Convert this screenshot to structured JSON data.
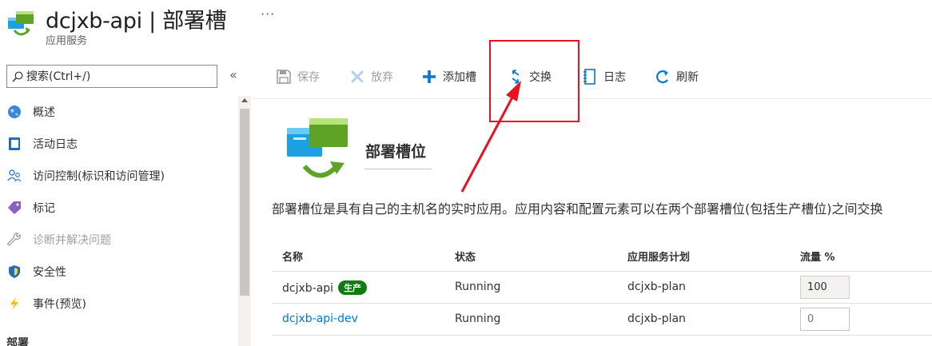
{
  "header": {
    "title": "dcjxb-api | 部署槽",
    "more": "···",
    "subtitle": "应用服务",
    "icon": "app-service-slots-icon"
  },
  "sidebar": {
    "search_placeholder": "搜索(Ctrl+/)",
    "collapse_glyph": "«",
    "items": [
      {
        "label": "概述",
        "icon": "globe-icon",
        "disabled": false
      },
      {
        "label": "活动日志",
        "icon": "activity-log-icon",
        "disabled": false
      },
      {
        "label": "访问控制(标识和访问管理)",
        "icon": "people-icon",
        "disabled": false
      },
      {
        "label": "标记",
        "icon": "tag-icon",
        "disabled": false
      },
      {
        "label": "诊断并解决问题",
        "icon": "wrench-icon",
        "disabled": true
      },
      {
        "label": "安全性",
        "icon": "shield-icon",
        "disabled": false
      },
      {
        "label": "事件(预览)",
        "icon": "lightning-icon",
        "disabled": false
      }
    ],
    "section": "部署"
  },
  "toolbar": {
    "save": "保存",
    "discard": "放弃",
    "add_slot": "添加槽",
    "swap": "交换",
    "logs": "日志",
    "refresh": "刷新"
  },
  "main": {
    "section_title": "部署槽位",
    "description": "部署槽位是具有自己的主机名的实时应用。应用内容和配置元素可以在两个部署槽位(包括生产槽位)之间交换"
  },
  "table": {
    "columns": [
      "名称",
      "状态",
      "应用服务计划",
      "流量 %"
    ],
    "rows": [
      {
        "name": "dcjxb-api",
        "badge": "生产",
        "status": "Running",
        "plan": "dcjxb-plan",
        "traffic": "100",
        "link": false
      },
      {
        "name": "dcjxb-api-dev",
        "badge": "",
        "status": "Running",
        "plan": "dcjxb-plan",
        "traffic": "0",
        "link": true
      }
    ]
  },
  "colors": {
    "accent": "#0078d4",
    "production_badge": "#107c10",
    "annotation": "#e81123"
  }
}
